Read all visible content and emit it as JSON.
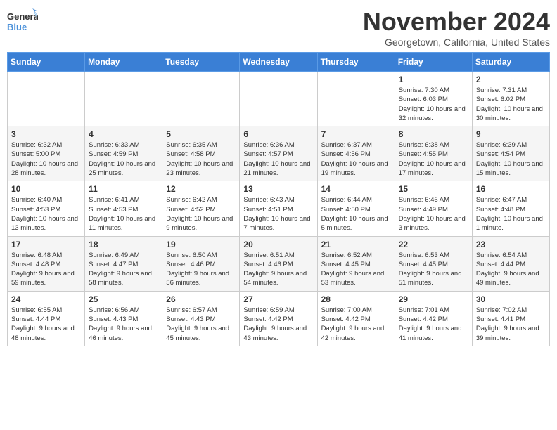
{
  "logo": {
    "line1": "General",
    "line2": "Blue"
  },
  "title": "November 2024",
  "location": "Georgetown, California, United States",
  "days_header": [
    "Sunday",
    "Monday",
    "Tuesday",
    "Wednesday",
    "Thursday",
    "Friday",
    "Saturday"
  ],
  "weeks": [
    [
      {
        "day": "",
        "info": ""
      },
      {
        "day": "",
        "info": ""
      },
      {
        "day": "",
        "info": ""
      },
      {
        "day": "",
        "info": ""
      },
      {
        "day": "",
        "info": ""
      },
      {
        "day": "1",
        "info": "Sunrise: 7:30 AM\nSunset: 6:03 PM\nDaylight: 10 hours and 32 minutes."
      },
      {
        "day": "2",
        "info": "Sunrise: 7:31 AM\nSunset: 6:02 PM\nDaylight: 10 hours and 30 minutes."
      }
    ],
    [
      {
        "day": "3",
        "info": "Sunrise: 6:32 AM\nSunset: 5:00 PM\nDaylight: 10 hours and 28 minutes."
      },
      {
        "day": "4",
        "info": "Sunrise: 6:33 AM\nSunset: 4:59 PM\nDaylight: 10 hours and 25 minutes."
      },
      {
        "day": "5",
        "info": "Sunrise: 6:35 AM\nSunset: 4:58 PM\nDaylight: 10 hours and 23 minutes."
      },
      {
        "day": "6",
        "info": "Sunrise: 6:36 AM\nSunset: 4:57 PM\nDaylight: 10 hours and 21 minutes."
      },
      {
        "day": "7",
        "info": "Sunrise: 6:37 AM\nSunset: 4:56 PM\nDaylight: 10 hours and 19 minutes."
      },
      {
        "day": "8",
        "info": "Sunrise: 6:38 AM\nSunset: 4:55 PM\nDaylight: 10 hours and 17 minutes."
      },
      {
        "day": "9",
        "info": "Sunrise: 6:39 AM\nSunset: 4:54 PM\nDaylight: 10 hours and 15 minutes."
      }
    ],
    [
      {
        "day": "10",
        "info": "Sunrise: 6:40 AM\nSunset: 4:53 PM\nDaylight: 10 hours and 13 minutes."
      },
      {
        "day": "11",
        "info": "Sunrise: 6:41 AM\nSunset: 4:53 PM\nDaylight: 10 hours and 11 minutes."
      },
      {
        "day": "12",
        "info": "Sunrise: 6:42 AM\nSunset: 4:52 PM\nDaylight: 10 hours and 9 minutes."
      },
      {
        "day": "13",
        "info": "Sunrise: 6:43 AM\nSunset: 4:51 PM\nDaylight: 10 hours and 7 minutes."
      },
      {
        "day": "14",
        "info": "Sunrise: 6:44 AM\nSunset: 4:50 PM\nDaylight: 10 hours and 5 minutes."
      },
      {
        "day": "15",
        "info": "Sunrise: 6:46 AM\nSunset: 4:49 PM\nDaylight: 10 hours and 3 minutes."
      },
      {
        "day": "16",
        "info": "Sunrise: 6:47 AM\nSunset: 4:48 PM\nDaylight: 10 hours and 1 minute."
      }
    ],
    [
      {
        "day": "17",
        "info": "Sunrise: 6:48 AM\nSunset: 4:48 PM\nDaylight: 9 hours and 59 minutes."
      },
      {
        "day": "18",
        "info": "Sunrise: 6:49 AM\nSunset: 4:47 PM\nDaylight: 9 hours and 58 minutes."
      },
      {
        "day": "19",
        "info": "Sunrise: 6:50 AM\nSunset: 4:46 PM\nDaylight: 9 hours and 56 minutes."
      },
      {
        "day": "20",
        "info": "Sunrise: 6:51 AM\nSunset: 4:46 PM\nDaylight: 9 hours and 54 minutes."
      },
      {
        "day": "21",
        "info": "Sunrise: 6:52 AM\nSunset: 4:45 PM\nDaylight: 9 hours and 53 minutes."
      },
      {
        "day": "22",
        "info": "Sunrise: 6:53 AM\nSunset: 4:45 PM\nDaylight: 9 hours and 51 minutes."
      },
      {
        "day": "23",
        "info": "Sunrise: 6:54 AM\nSunset: 4:44 PM\nDaylight: 9 hours and 49 minutes."
      }
    ],
    [
      {
        "day": "24",
        "info": "Sunrise: 6:55 AM\nSunset: 4:44 PM\nDaylight: 9 hours and 48 minutes."
      },
      {
        "day": "25",
        "info": "Sunrise: 6:56 AM\nSunset: 4:43 PM\nDaylight: 9 hours and 46 minutes."
      },
      {
        "day": "26",
        "info": "Sunrise: 6:57 AM\nSunset: 4:43 PM\nDaylight: 9 hours and 45 minutes."
      },
      {
        "day": "27",
        "info": "Sunrise: 6:59 AM\nSunset: 4:42 PM\nDaylight: 9 hours and 43 minutes."
      },
      {
        "day": "28",
        "info": "Sunrise: 7:00 AM\nSunset: 4:42 PM\nDaylight: 9 hours and 42 minutes."
      },
      {
        "day": "29",
        "info": "Sunrise: 7:01 AM\nSunset: 4:42 PM\nDaylight: 9 hours and 41 minutes."
      },
      {
        "day": "30",
        "info": "Sunrise: 7:02 AM\nSunset: 4:41 PM\nDaylight: 9 hours and 39 minutes."
      }
    ]
  ]
}
